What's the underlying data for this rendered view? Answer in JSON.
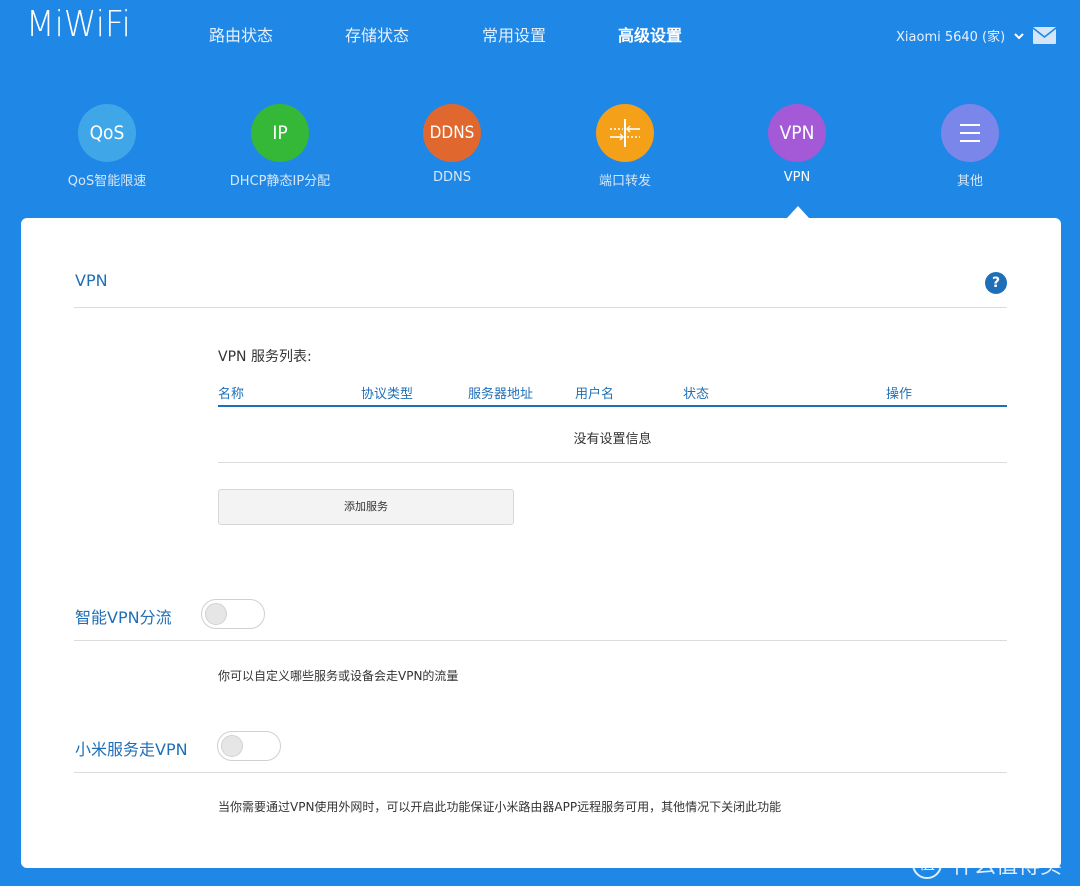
{
  "app": {
    "logo": "MiWiFi"
  },
  "nav": {
    "items": [
      {
        "label": "路由状态"
      },
      {
        "label": "存储状态"
      },
      {
        "label": "常用设置"
      },
      {
        "label": "高级设置",
        "active": true
      }
    ]
  },
  "user": {
    "label": "Xiaomi 5640 (家)",
    "chevron": "chevron-down-icon",
    "mail": "mail-icon"
  },
  "tiles": [
    {
      "icon_text": "QoS",
      "label": "QoS智能限速",
      "color": "#3fa6e8"
    },
    {
      "icon_text": "IP",
      "label": "DHCP静态IP分配",
      "color": "#35b837"
    },
    {
      "icon_text": "DDNS",
      "label": "DDNS",
      "color": "#e0682f"
    },
    {
      "icon_text": "",
      "icon": "port-forward-icon",
      "label": "端口转发",
      "color": "#f5a019"
    },
    {
      "icon_text": "VPN",
      "label": "VPN",
      "color": "#a45ad6",
      "active": true
    },
    {
      "icon_text": "",
      "icon": "menu-icon",
      "label": "其他",
      "color": "#7a86ea"
    }
  ],
  "vpn": {
    "title": "VPN",
    "help": "?",
    "list_title": "VPN 服务列表:",
    "columns": [
      "名称",
      "协议类型",
      "服务器地址",
      "用户名",
      "状态",
      "操作"
    ],
    "empty_message": "没有设置信息",
    "add_button": "添加服务"
  },
  "smart_vpn": {
    "title": "智能VPN分流",
    "enabled": false,
    "description": "你可以自定义哪些服务或设备会走VPN的流量"
  },
  "mi_service_vpn": {
    "title": "小米服务走VPN",
    "enabled": false,
    "description": "当你需要通过VPN使用外网时，可以开启此功能保证小米路由器APP远程服务可用，其他情况下关闭此功能"
  },
  "watermark": {
    "mark": "值",
    "text": "什么值得买"
  },
  "colors": {
    "background": "#1f87e6",
    "accent": "#1f6fb8"
  }
}
